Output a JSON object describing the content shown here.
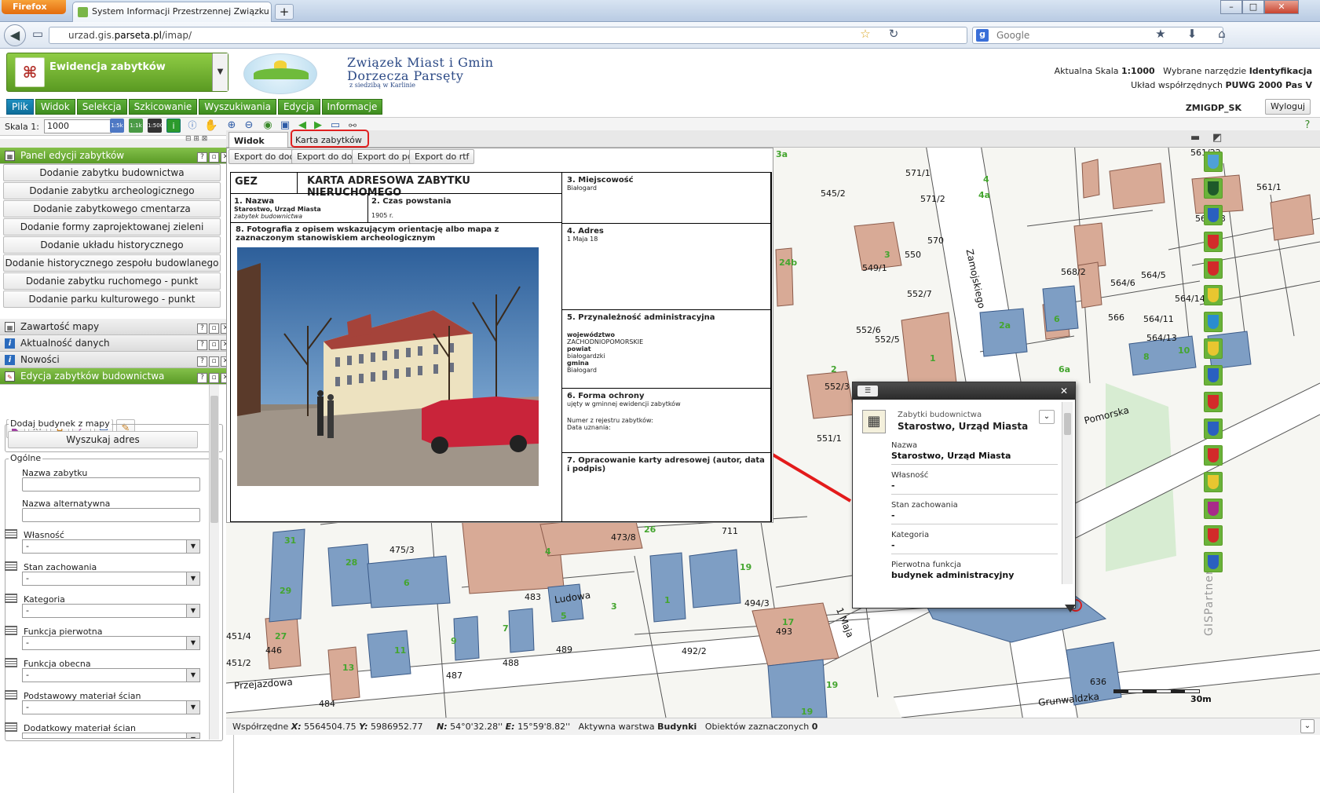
{
  "browser": {
    "app_button": "Firefox",
    "tab_title": "System Informacji Przestrzennej Związku Mi...",
    "new_tab": "+",
    "url_prefix": "urzad.gis.",
    "url_host": "parseta.pl",
    "url_path": "/imap/",
    "search_placeholder": "Google",
    "win_min": "–",
    "win_max": "□",
    "win_close": "✕"
  },
  "header": {
    "module_label": "Ewidencja zabytków",
    "org_line1": "Związek Miast i Gmin",
    "org_line2": "Dorzecza Parsęty",
    "org_line3": "z siedzibą w Karlinie",
    "scale_label": "Aktualna Skala ",
    "scale_value": "1:1000",
    "tool_label": "Wybrane narzędzie ",
    "tool_value": "Identyfikacja",
    "coord_label": "Układ współrzędnych ",
    "coord_value": "PUWG 2000 Pas V",
    "user": "ZMIGDP_SK",
    "logout": "Wyloguj"
  },
  "menu": [
    "Plik",
    "Widok",
    "Selekcja",
    "Szkicowanie",
    "Wyszukiwania",
    "Edycja",
    "Informacje"
  ],
  "toolbar": {
    "scale_label": "Skala 1:",
    "scale_value": "1000",
    "help": "?"
  },
  "left": {
    "panel_title": "Panel edycji zabytków",
    "actions": [
      "Dodanie zabytku budownictwa",
      "Dodanie zabytku archeologicznego",
      "Dodanie zabytkowego cmentarza",
      "Dodanie formy zaprojektowanej zieleni",
      "Dodanie układu historycznego",
      "Dodanie historycznego zespołu budowlanego",
      "Dodanie zabytku ruchomego - punkt",
      "Dodanie parku kulturowego - punkt"
    ],
    "panels": [
      "Zawartość mapy",
      "Aktualność danych",
      "Nowości",
      "Edycja zabytków budownictwa"
    ],
    "add_group": "Dodaj budynek z mapy",
    "find_address": "Wyszukaj adres",
    "general_group": "Ogólne",
    "name_label": "Nazwa zabytku",
    "alt_name_label": "Nazwa alternatywna",
    "selects": [
      "Własność",
      "Stan zachowania",
      "Kategoria",
      "Funkcja pierwotna",
      "Funkcja obecna",
      "Podstawowy materiał ścian",
      "Dodatkowy materiał ścian"
    ],
    "select_value": "-"
  },
  "tabs": {
    "map": "Widok mapy",
    "card": "Karta zabytków"
  },
  "exports": [
    "Export do docx",
    "Export do doc",
    "Export do pdf",
    "Export do rtf"
  ],
  "card": {
    "code": "GEZ",
    "title": "KARTA ADRESOWA ZABYTKU NIERUCHOMEGO",
    "f1": "1. Nazwa",
    "f1_val": "Starostwo, Urząd Miasta",
    "f1_sub": "zabytek budownictwa",
    "f2": "2. Czas powstania",
    "f2_val": "1905 r.",
    "f3": "3. Miejscowość",
    "f3_val": "Białogard",
    "f4": "4. Adres",
    "f4_val": "1 Maja 18",
    "f5": "5. Przynależność administracyjna",
    "f5_woj_l": "województwo",
    "f5_woj": "ZACHODNIOPOMORSKIE",
    "f5_pow_l": "powiat",
    "f5_pow": "białogardzki",
    "f5_gm_l": "gmina",
    "f5_gm": "Białogard",
    "f6": "6. Forma ochrony",
    "f6_val": "ujęty w gminnej ewidencji zabytków",
    "f6_reg": "Numer z rejestru zabytków:",
    "f6_date": "Data uznania:",
    "f7": "7. Opracowanie karty adresowej (autor, data i podpis)",
    "f8": "8. Fotografia z opisem wskazującym orientację albo mapa z zaznaczonym stanowiskiem archeologicznym"
  },
  "popup": {
    "category": "Zabytki budownictwa",
    "title": "Starostwo, Urząd Miasta",
    "fields": [
      {
        "label": "Nazwa",
        "value": "Starostwo, Urząd Miasta"
      },
      {
        "label": "Własność",
        "value": "-"
      },
      {
        "label": "Stan zachowania",
        "value": "-"
      },
      {
        "label": "Kategoria",
        "value": "-"
      },
      {
        "label": "Pierwotna funkcja",
        "value": "budynek administracyjny"
      }
    ]
  },
  "map_labels": {
    "streets": [
      "Zamojskiego",
      "Pomorska",
      "Ludowa",
      "1 Maja",
      "Przejazdowa",
      "Grunwaldzka"
    ],
    "parcels": [
      "545/2",
      "571/1",
      "571/2",
      "570",
      "550",
      "549/1",
      "552/7",
      "566",
      "568/2",
      "552/6",
      "552/5",
      "552/3",
      "551/1",
      "561/22",
      "561/1",
      "561/18",
      "564/5",
      "564/6",
      "564/11",
      "564/13",
      "564/14",
      "475/3",
      "473/8",
      "483",
      "489",
      "487",
      "488",
      "492/2",
      "494/3",
      "493",
      "446",
      "451/4",
      "451/2",
      "484",
      "636",
      "711"
    ],
    "numbers": [
      "3a",
      "4",
      "4a",
      "1",
      "2",
      "3",
      "24b",
      "2",
      "1",
      "2a",
      "6",
      "6a",
      "8",
      "10",
      "31",
      "29",
      "27",
      "28",
      "6",
      "4",
      "28",
      "26",
      "3",
      "1",
      "5",
      "7",
      "9",
      "11",
      "13",
      "19",
      "17",
      "19",
      "19"
    ],
    "scalebar": "30m",
    "watermark": "GISPartner"
  },
  "status": {
    "coords_label": "Współrzędne ",
    "x": "5564504.75",
    "y": "5986952.77",
    "n": "54°0'32.28''",
    "e": "15°59'8.82''",
    "layer_label": "Aktywna warstwa ",
    "layer": "Budynki",
    "sel_label": "Obiektów zaznaczonych ",
    "sel": "0"
  }
}
